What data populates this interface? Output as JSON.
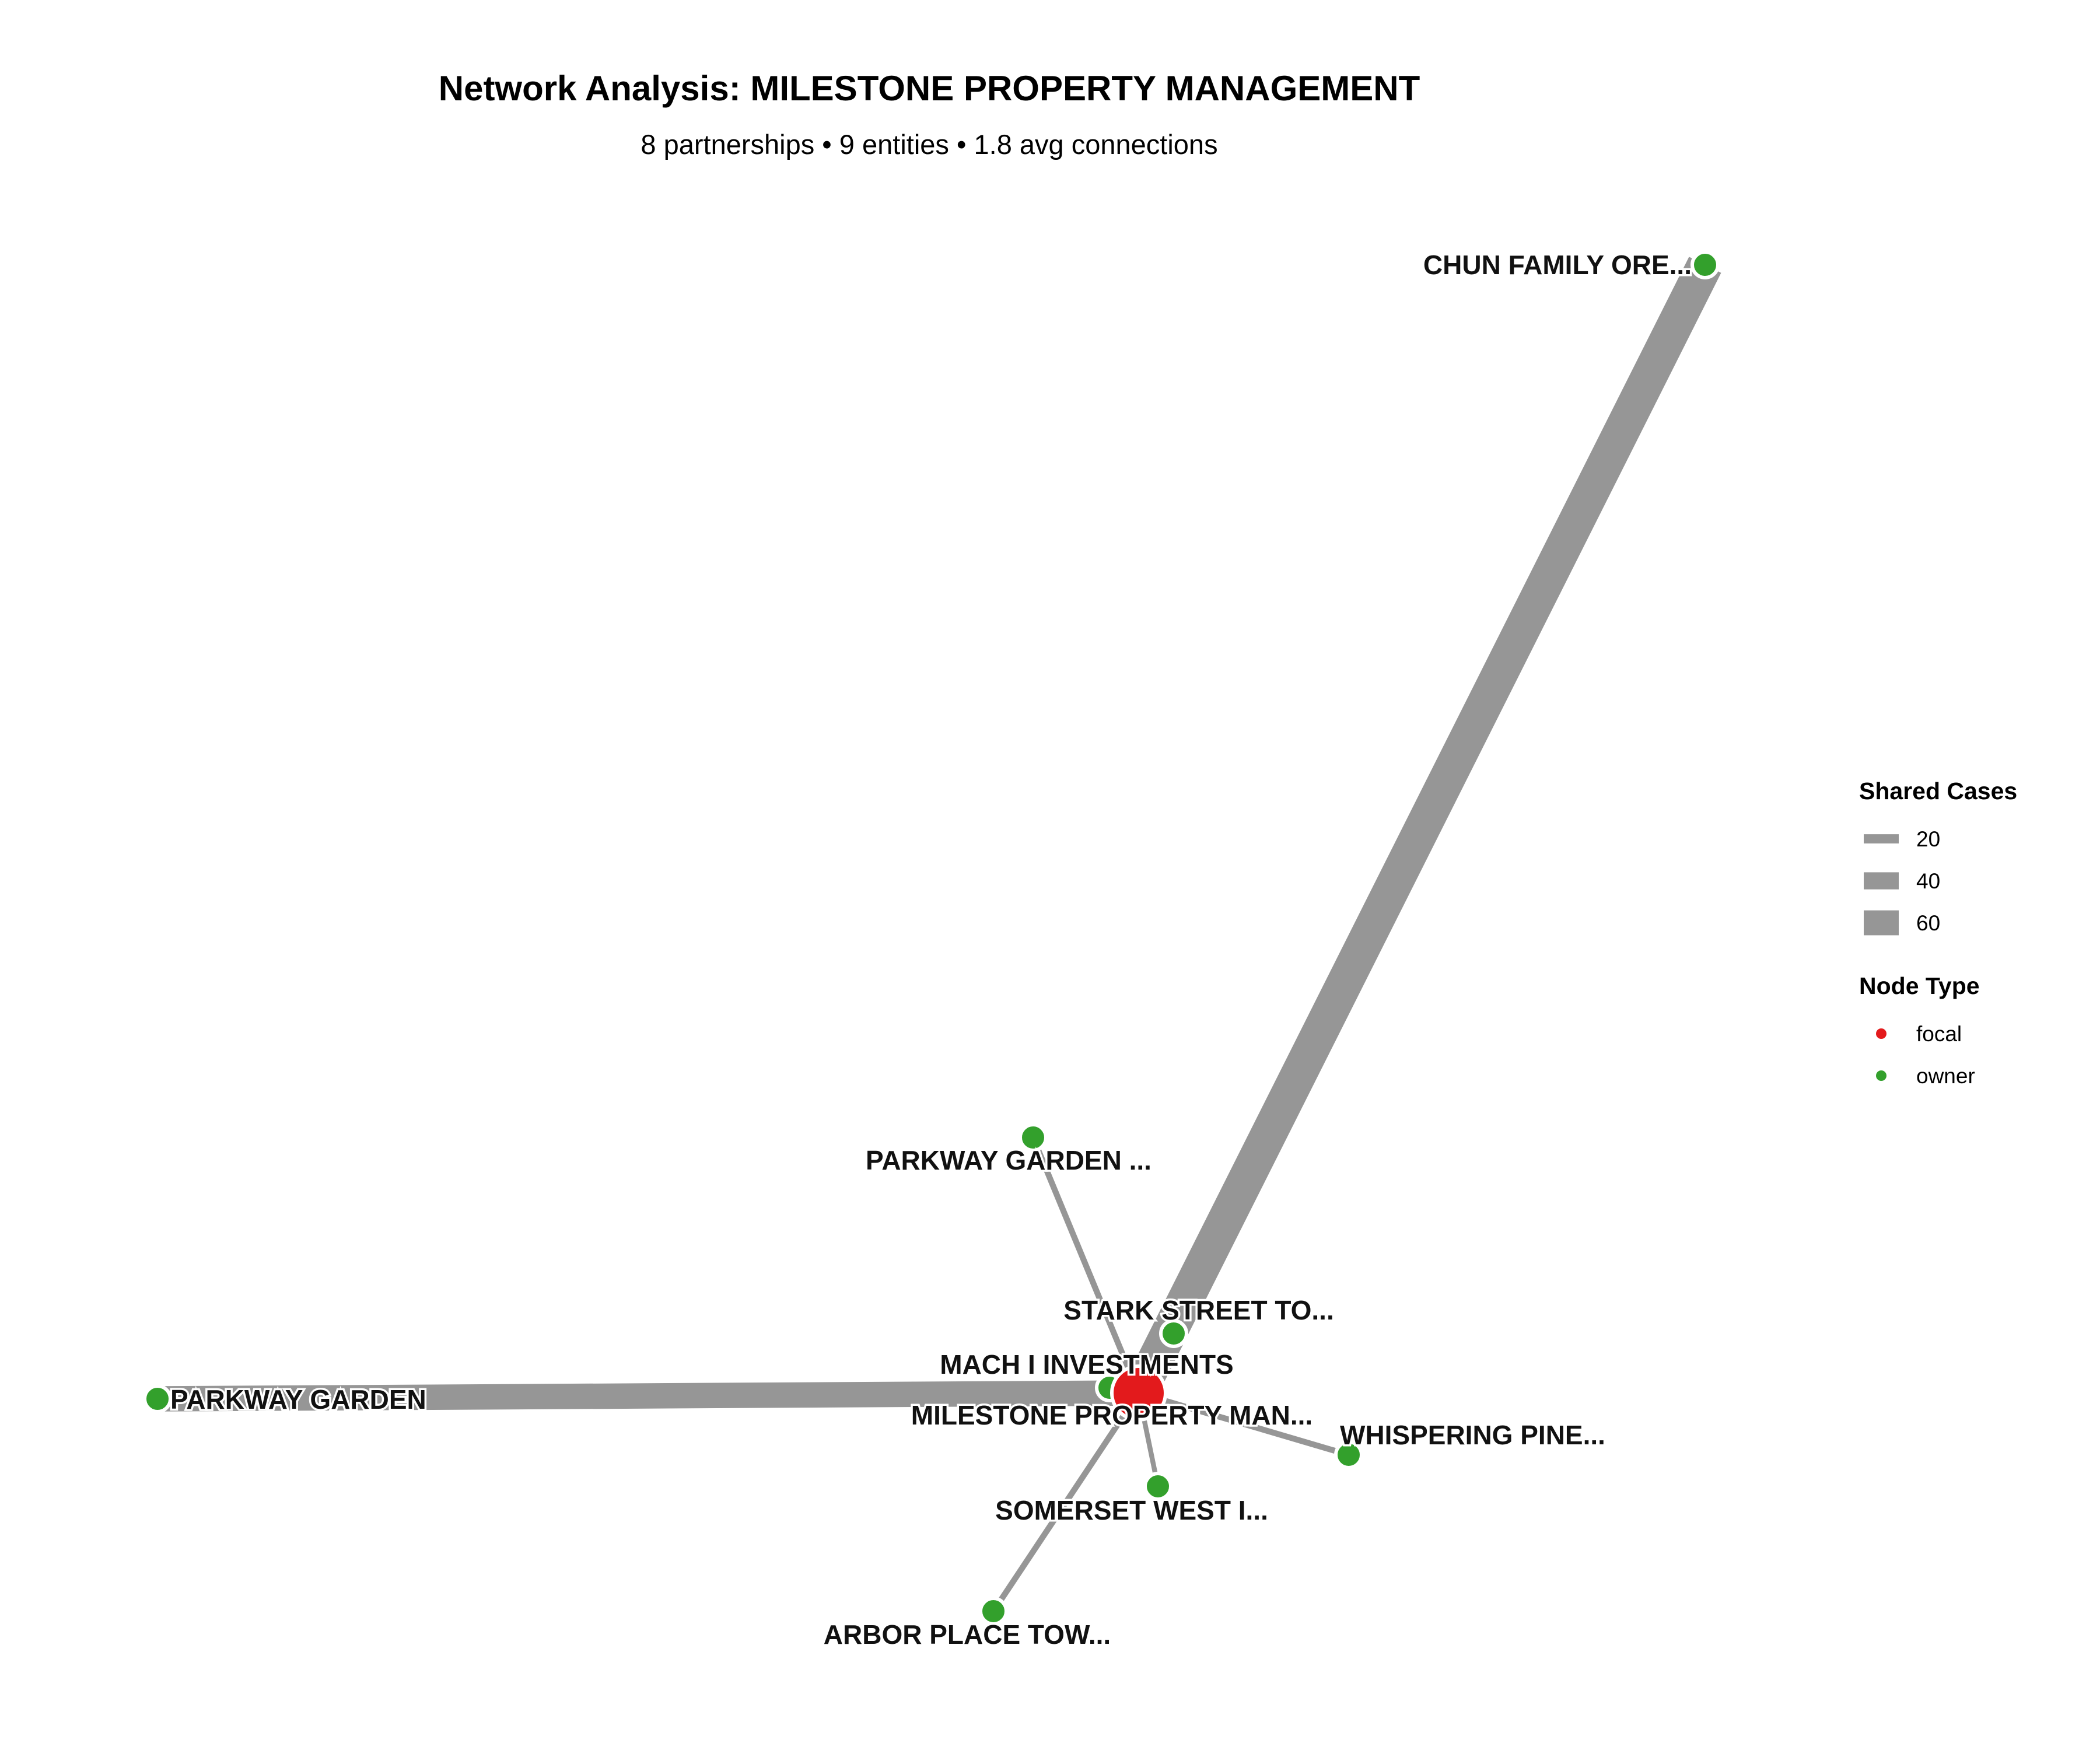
{
  "title": "Network Analysis: MILESTONE PROPERTY MANAGEMENT",
  "subtitle": "8 partnerships • 9 entities • 1.8 avg connections",
  "colors": {
    "edge": "#969696",
    "focal": "#e31a1c",
    "owner": "#33a02c",
    "node_stroke": "#ffffff"
  },
  "nodes": [
    {
      "id": "milestone",
      "label": "MILESTONE PROPERTY MAN...",
      "type": "focal"
    },
    {
      "id": "chun",
      "label": "CHUN FAMILY ORE...",
      "type": "owner"
    },
    {
      "id": "parkway_garden_left",
      "label": "PARKWAY GARDEN",
      "type": "owner"
    },
    {
      "id": "parkway_garden_top",
      "label": "PARKWAY GARDEN ...",
      "type": "owner"
    },
    {
      "id": "stark",
      "label": "STARK STREET TO...",
      "type": "owner"
    },
    {
      "id": "mach",
      "label": "MACH I INVESTMENTS",
      "type": "owner"
    },
    {
      "id": "whispering",
      "label": "WHISPERING PINE...",
      "type": "owner"
    },
    {
      "id": "somerset",
      "label": "SOMERSET WEST I...",
      "type": "owner"
    },
    {
      "id": "arbor",
      "label": "ARBOR PLACE TOW...",
      "type": "owner"
    }
  ],
  "edges": [
    {
      "source": "milestone",
      "target": "chun",
      "shared_cases": 65
    },
    {
      "source": "milestone",
      "target": "parkway_garden_left",
      "shared_cases": 45
    },
    {
      "source": "milestone",
      "target": "parkway_garden_top",
      "shared_cases": 8
    },
    {
      "source": "milestone",
      "target": "stark",
      "shared_cases": 10
    },
    {
      "source": "milestone",
      "target": "mach",
      "shared_cases": 6
    },
    {
      "source": "milestone",
      "target": "whispering",
      "shared_cases": 8
    },
    {
      "source": "milestone",
      "target": "somerset",
      "shared_cases": 6
    },
    {
      "source": "milestone",
      "target": "arbor",
      "shared_cases": 8
    }
  ],
  "legend": {
    "edge_title": "Shared Cases",
    "edge_items": [
      {
        "label": "20",
        "value": 20
      },
      {
        "label": "40",
        "value": 40
      },
      {
        "label": "60",
        "value": 60
      }
    ],
    "node_title": "Node Type",
    "node_items": [
      {
        "label": "focal",
        "type": "focal"
      },
      {
        "label": "owner",
        "type": "owner"
      }
    ]
  }
}
